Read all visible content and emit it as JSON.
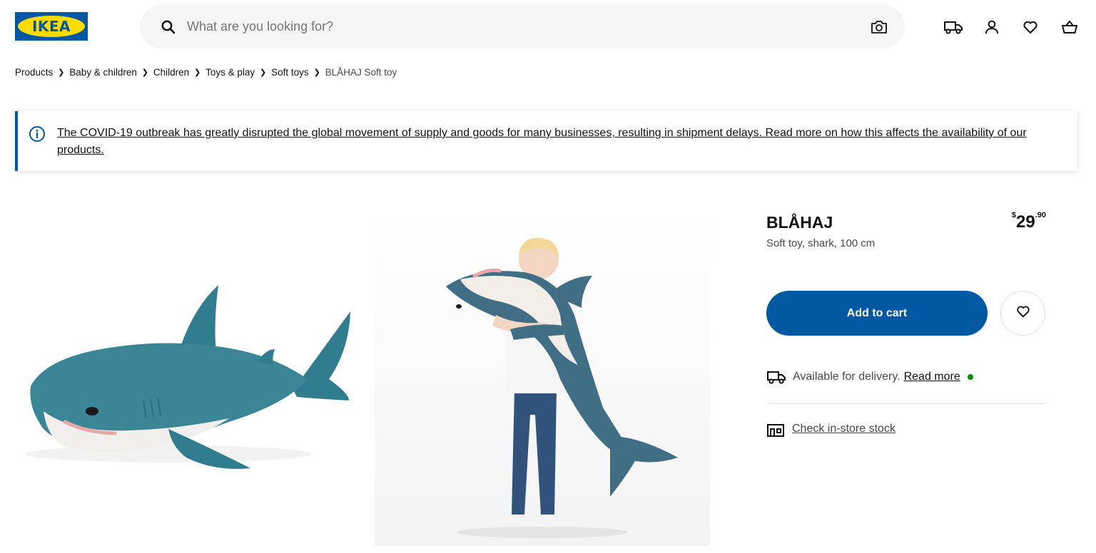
{
  "header": {
    "logo_text": "IKEA",
    "search_placeholder": "What are you looking for?",
    "icons": [
      "search-icon",
      "camera-icon",
      "delivery-truck-icon",
      "account-icon",
      "heart-icon",
      "shopping-bag-icon"
    ]
  },
  "breadcrumb": [
    {
      "label": "Products"
    },
    {
      "label": "Baby & children"
    },
    {
      "label": "Children"
    },
    {
      "label": "Toys & play"
    },
    {
      "label": "Soft toys"
    },
    {
      "label": "BLÅHAJ Soft toy"
    }
  ],
  "banner": {
    "text": "The COVID-19 outbreak has greatly disrupted the global movement of supply and goods for many businesses, resulting in shipment delays. Read more on how this affects the availability of our products."
  },
  "product": {
    "name": "BLÅHAJ",
    "description": "Soft toy, shark, 100 cm",
    "price": {
      "currency": "$",
      "integer": "29",
      "decimal": ".90"
    },
    "add_to_cart_label": "Add to cart",
    "delivery_text": "Available for delivery.",
    "delivery_link": "Read more",
    "store_stock_label": "Check in-store stock"
  },
  "colors": {
    "brand_blue": "#0058a3",
    "brand_yellow": "#ffdb00",
    "shark_blue": "#3a8596",
    "available_green": "#0a8a00"
  }
}
